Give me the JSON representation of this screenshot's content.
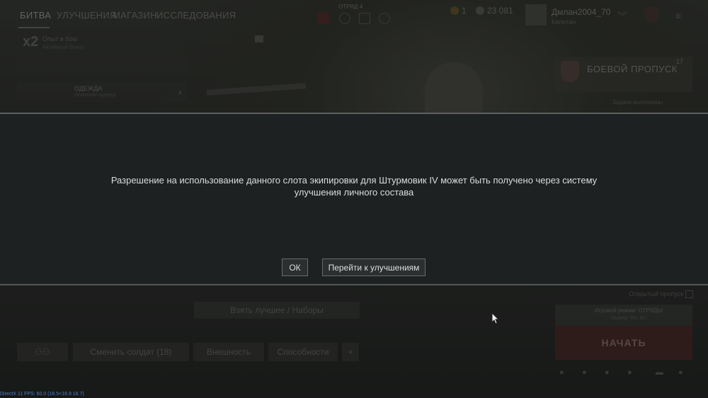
{
  "nav": {
    "tabs": [
      "БИТВА",
      "УЛУЧШЕНИЯ",
      "МАГАЗИН",
      "ИССЛЕДОВАНИЯ"
    ],
    "center_label": "ОТРЯД 4",
    "gold": "1",
    "silver": "23 081",
    "username": "Дмлан2004_70",
    "rank": "Капитан"
  },
  "panel": {
    "x2": "x2",
    "x2_title": "Опыт в бою",
    "x2_sub": "Активный бонус",
    "squad_label": "ОДЕЖДА",
    "squad_sub": "Основная одежда"
  },
  "battle_pass": {
    "title": "БОЕВОЙ ПРОПУСК",
    "level": "17",
    "sub": "Задачи выполнены"
  },
  "dialog": {
    "message": "Разрешение на использование данного слота экипировки для Штурмовик IV может быть получено через систему улучшения личного состава",
    "ok_label": "ОК",
    "go_label": "Перейти к улучшениям"
  },
  "bottom": {
    "best_label": "Взять лучшее / Наборы",
    "change_soldier": "Сменить солдат (18)",
    "appearance": "Внешность",
    "abilities": "Способности",
    "quick_play": "Открытый пропуск",
    "mode_title": "Игровой режим: ОТРЯДЫ",
    "mode_sub": "Сервер: RU, EU",
    "start_label": "НАЧАТЬ",
    "fps": "DirectX 11 FPS: 60.0 (16.5<16.9 16.7)"
  }
}
